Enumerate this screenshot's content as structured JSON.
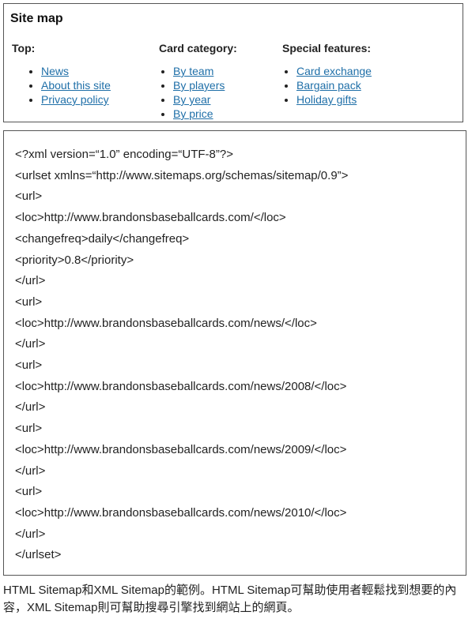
{
  "sitemap": {
    "title": "Site map",
    "columns": [
      {
        "heading": "Top:",
        "links": [
          "News",
          "About this site",
          "Privacy policy"
        ]
      },
      {
        "heading": "Card category:",
        "links": [
          "By team",
          "By players",
          "By year",
          "By price"
        ]
      },
      {
        "heading": "Special features:",
        "links": [
          "Card exchange",
          "Bargain pack",
          "Holiday gifts"
        ]
      }
    ],
    "link_color": "#1f6fa8"
  },
  "xml": {
    "lines": [
      "<?xml version=“1.0” encoding=“UTF-8”?>",
      "<urlset xmlns=“http://www.sitemaps.org/schemas/sitemap/0.9”>",
      "<url>",
      "<loc>http://www.brandonsbaseballcards.com/</loc>",
      "<changefreq>daily</changefreq>",
      "<priority>0.8</priority>",
      "</url>",
      "<url>",
      "<loc>http://www.brandonsbaseballcards.com/news/</loc>",
      "</url>",
      "<url>",
      "<loc>http://www.brandonsbaseballcards.com/news/2008/</loc>",
      "</url>",
      "<url>",
      "<loc>http://www.brandonsbaseballcards.com/news/2009/</loc>",
      "</url>",
      "<url>",
      "<loc>http://www.brandonsbaseballcards.com/news/2010/</loc>",
      "</url>",
      "</urlset>"
    ]
  },
  "caption": "HTML Sitemap和XML Sitemap的範例。HTML Sitemap可幫助使用者輕鬆找到想要的內容，XML Sitemap則可幫助搜尋引擎找到網站上的網頁。"
}
